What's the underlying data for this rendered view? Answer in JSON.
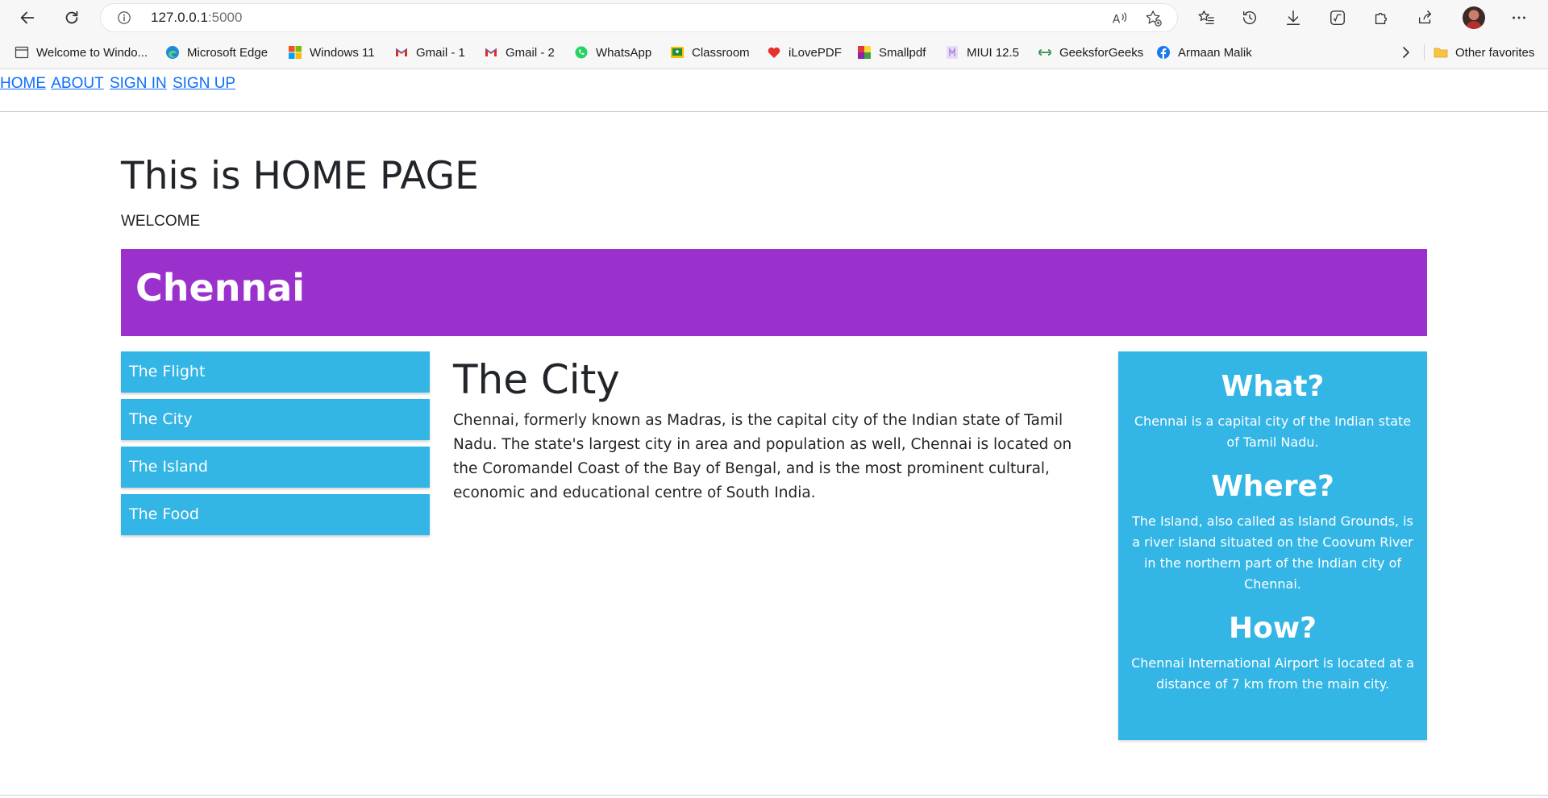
{
  "browser": {
    "url_host": "127.0.0.1",
    "url_port": ":5000",
    "bookmarks": [
      {
        "label": "Welcome to Windo...",
        "icon": "page-icon"
      },
      {
        "label": "Microsoft Edge",
        "icon": "edge-icon"
      },
      {
        "label": "Windows 11",
        "icon": "windows-icon"
      },
      {
        "label": "Gmail - 1",
        "icon": "gmail-icon"
      },
      {
        "label": "Gmail - 2",
        "icon": "gmail-icon"
      },
      {
        "label": "WhatsApp",
        "icon": "whatsapp-icon"
      },
      {
        "label": "Classroom",
        "icon": "classroom-icon"
      },
      {
        "label": "iLovePDF",
        "icon": "ilovepdf-icon"
      },
      {
        "label": "Smallpdf",
        "icon": "smallpdf-icon"
      },
      {
        "label": "MIUI 12.5",
        "icon": "miui-icon"
      },
      {
        "label": "GeeksforGeeks",
        "icon": "geeksforgeeks-icon"
      },
      {
        "label": "Armaan Malik",
        "icon": "facebook-icon"
      }
    ],
    "other_favorites": "Other favorites"
  },
  "nav": {
    "home": "HOME",
    "about": "ABOUT",
    "signin": "SIGN IN",
    "signup": "SIGN UP"
  },
  "page": {
    "title": "This is HOME PAGE",
    "welcome": "WELCOME"
  },
  "banner": {
    "title": "Chennai"
  },
  "sidebar": {
    "items": [
      {
        "label": "The Flight"
      },
      {
        "label": "The City"
      },
      {
        "label": "The Island"
      },
      {
        "label": "The Food"
      }
    ]
  },
  "main": {
    "heading": "The City",
    "text": "Chennai, formerly known as Madras, is the capital city of the Indian state of Tamil Nadu. The state's largest city in area and population as well, Chennai is located on the Coromandel Coast of the Bay of Bengal, and is the most prominent cultural, economic and educational centre of South India."
  },
  "aside": {
    "what_heading": "What?",
    "what_text": "Chennai is a capital city of the Indian state of Tamil Nadu.",
    "where_heading": "Where?",
    "where_text": "The Island, also called as Island Grounds, is a river island situated on the Coovum River in the northern part of the Indian city of Chennai.",
    "how_heading": "How?",
    "how_text": "Chennai International Airport is located at a distance of 7 km from the main city."
  },
  "colors": {
    "banner": "#9b31cc",
    "panel": "#33b5e5",
    "link": "#0d6efd"
  }
}
